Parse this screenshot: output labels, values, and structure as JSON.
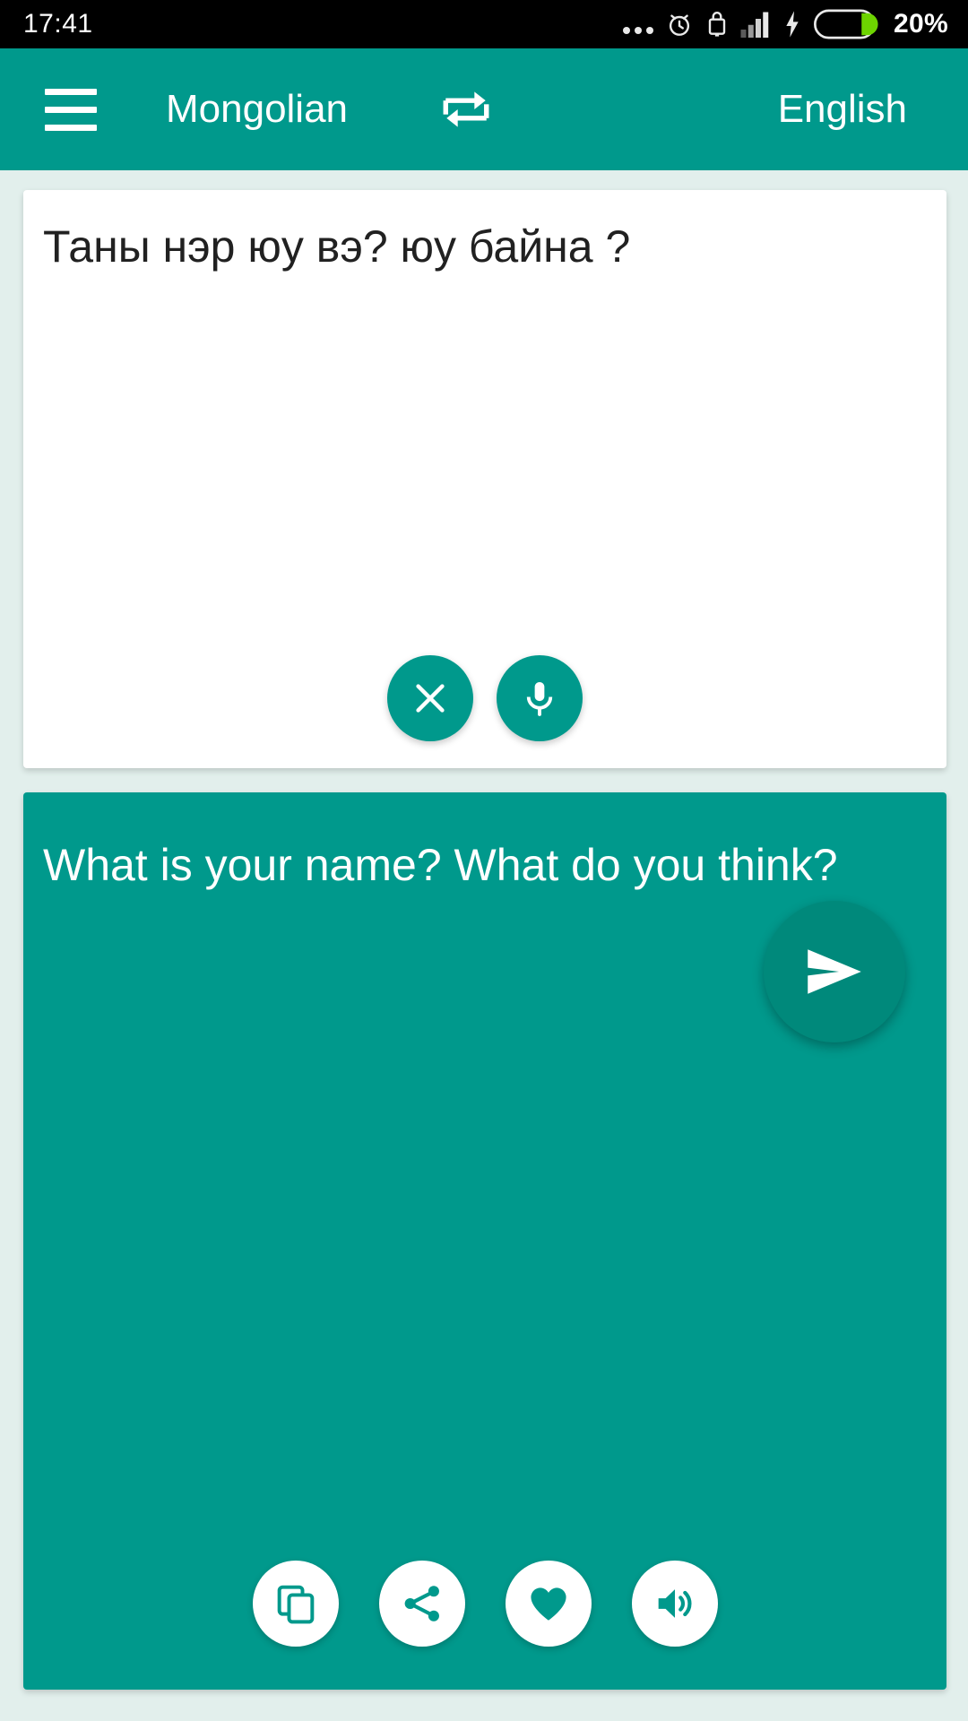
{
  "status_bar": {
    "time": "17:41",
    "battery_percent": "20%",
    "icons": [
      "ellipsis-icon",
      "alarm-clock-icon",
      "screen-lock-icon",
      "signal-bars-icon",
      "charging-bolt-icon",
      "battery-icon"
    ],
    "battery_fill_color": "#6dd400",
    "background_color": "#000000"
  },
  "header": {
    "menu_icon": "hamburger-menu-icon",
    "source_language": "Mongolian",
    "swap_icon": "swap-languages-icon",
    "target_language": "English",
    "background_color": "#00998c"
  },
  "input_card": {
    "text": "Таны нэр юу вэ? юу байна ?",
    "placeholder": "",
    "background_color": "#ffffff",
    "actions": [
      {
        "name": "clear-button",
        "icon": "close-x-icon",
        "label": "Clear"
      },
      {
        "name": "microphone-button",
        "icon": "microphone-icon",
        "label": "Voice input"
      }
    ]
  },
  "send_button": {
    "icon": "send-icon",
    "label": "Translate",
    "color": "#00897b"
  },
  "output_card": {
    "text": "What is your name? What do you think?",
    "background_color": "#00998c",
    "actions": [
      {
        "name": "copy-button",
        "icon": "copy-icon",
        "label": "Copy"
      },
      {
        "name": "share-button",
        "icon": "share-icon",
        "label": "Share"
      },
      {
        "name": "favorite-button",
        "icon": "heart-icon",
        "label": "Favorite"
      },
      {
        "name": "speak-button",
        "icon": "speaker-icon",
        "label": "Listen"
      }
    ]
  },
  "page": {
    "background_color": "#e2efec"
  }
}
